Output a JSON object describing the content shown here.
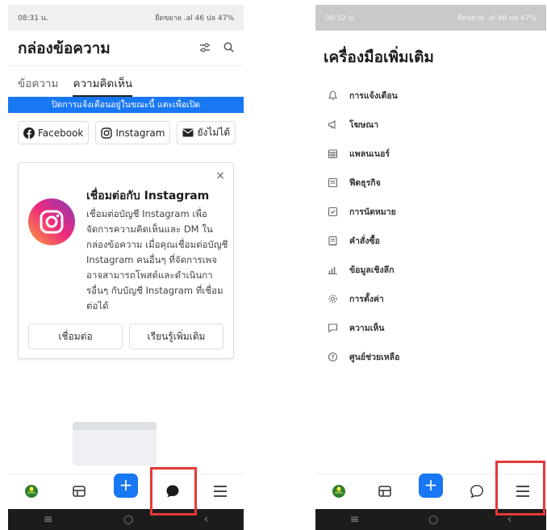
{
  "left": {
    "status": {
      "time": "08:31 น.",
      "right": "ยืดขยาย .al 46 ปล 47%"
    },
    "header": {
      "title": "กล่องข้อความ"
    },
    "tabs": [
      {
        "label": "ข้อความ"
      },
      {
        "label": "ความคิดเห็น"
      }
    ],
    "banner": "ปิดการแจ้งเตือนอยู่ในขณะนี้ แตะเพื่อเปิด",
    "channels": [
      {
        "label": "Facebook"
      },
      {
        "label": "Instagram"
      },
      {
        "label": "ยังไม่ได้"
      }
    ],
    "card": {
      "title": "เชื่อมต่อกับ Instagram",
      "desc": "เชื่อมต่อบัญชี Instagram เพื่อจัดการความคิดเห็นและ DM ในกล่องข้อความ เมื่อคุณเชื่อมต่อบัญชี Instagram คนอื่นๆ ที่จัดการเพจอาจสามารถโพสต์และดำเนินการอื่นๆ กับบัญชี Instagram ที่เชื่อมต่อได้",
      "connect_label": "เชื่อมต่อ",
      "learn_label": "เรียนรู้เพิ่มเติม",
      "close": "×"
    },
    "nav": {
      "plus": "+"
    }
  },
  "right": {
    "status": {
      "time": "08:32 น.",
      "right": "ยืดขยาย .al 46 ปล 47%"
    },
    "title": "เครื่องมือเพิ่มเติม",
    "tools": [
      {
        "label": "การแจ้งเตือน",
        "icon": "bell-icon"
      },
      {
        "label": "โฆษณา",
        "icon": "megaphone-icon"
      },
      {
        "label": "แพลนเนอร์",
        "icon": "calendar-icon"
      },
      {
        "label": "ฟีดธุรกิจ",
        "icon": "feed-icon"
      },
      {
        "label": "การนัดหมาย",
        "icon": "checkbox-icon"
      },
      {
        "label": "คำสั่งซื้อ",
        "icon": "orders-icon"
      },
      {
        "label": "ข้อมูลเชิงลึก",
        "icon": "insights-icon"
      },
      {
        "label": "การตั้งค่า",
        "icon": "gear-icon"
      },
      {
        "label": "ความเห็น",
        "icon": "comment-icon"
      },
      {
        "label": "ศูนย์ช่วยเหลือ",
        "icon": "help-icon"
      }
    ],
    "nav": {
      "plus": "+"
    }
  },
  "colors": {
    "brand": "#1877f2",
    "highlight": "#e53935"
  }
}
